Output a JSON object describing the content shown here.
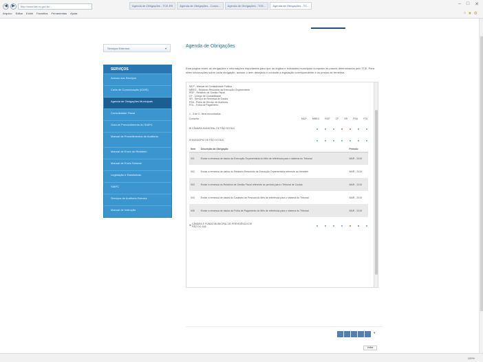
{
  "browser": {
    "address": "http://www.tce.rs.gov.br/...",
    "tabs": [
      "Agenda de Obrigações - TCE-RS",
      "Agenda de Obrigações - Conex...",
      "Agenda de Obrigações - TCE...",
      "Agenda de Obrigações - TC..."
    ],
    "menu": [
      "Arquivo",
      "Editar",
      "Exibir",
      "Favoritos",
      "Ferramentas",
      "Ajuda"
    ]
  },
  "sidebar": {
    "dropdown_label": "Serviços Externos",
    "header": "SERVIÇOS",
    "items": [
      "Acesso aos Serviços",
      "Carta de Comunicação (ICMS)",
      "Agenda de Obrigações Municipais",
      "Consolidador Fiscal",
      "Guia de Preenchimento do SIAPC",
      "Manual de Procedimentos de Auditoria",
      "Manual de Envio do Relatório",
      "Manual de Envio Setorial",
      "Legislação e Estatísticas",
      "SIAPC",
      "Serviços de Auditoria Externa",
      "Manual de Instrução"
    ]
  },
  "main": {
    "title": "Agenda de Obrigações",
    "intro": "Esta página reúne as obrigações e informações importantes para que os órgãos e entidades municipais cumpram os prazos determinados pelo TCE. Para obter informações sobre cada obrigação, acesse o item desejado e consulte a legislação correspondente e os prazos de remessa.",
    "legend": [
      "MCP - Manual de Contabilidade Pública",
      "MREO - Relatório Resumido da Execução Orçamentária",
      "RGF - Relatório de Gestão Fiscal",
      "CF - Código de Contabilidade",
      "SR - Serviço de Remessa de Dados",
      "PSA - Plano de Serviço de Auditoria",
      "FOL - Folha de Pagamento"
    ],
    "count_line": "1 - 3 de 3 - itens encontrados",
    "filter_label": "Consulta",
    "col_labels": [
      "MCP",
      "MREO",
      "RGF",
      "CF",
      "SR",
      "PSA",
      "FOL"
    ],
    "entities": [
      {
        "name": "CÂMARA MUNICIPAL DE PÃO DO SUL"
      },
      {
        "name": "MUNICÍPIO DE PÃO DO SUL"
      }
    ],
    "table": {
      "headers": [
        "Item",
        "Descrição da Obrigação",
        "Período"
      ],
      "rows": [
        {
          "item": "001",
          "desc": "Enviar a remessa de dados da Execução Orçamentária do Mês de referência para o sistema do Tribunal",
          "period": "MAR - 2019",
          "shaded": true
        },
        {
          "item": "002",
          "desc": "Enviar a remessa de dados do Relatório Resumido da Execução Orçamentária referente ao bimestre",
          "period": "MAR - 2019",
          "shaded": false
        },
        {
          "item": "003",
          "desc": "Enviar a remessa do Relatório de Gestão Fiscal referente ao período para o Tribunal de Contas",
          "period": "MAR - 2019",
          "shaded": true
        },
        {
          "item": "004",
          "desc": "Enviar a remessa de dados do Cadastro de Pessoal do Mês de referência para o sistema do Tribunal",
          "period": "MAR - 2019",
          "shaded": false
        },
        {
          "item": "005",
          "desc": "Enviar a remessa de dados da Folha de Pagamento do Mês de referência para o sistema do Tribunal",
          "period": "MAR - 2019",
          "shaded": true
        }
      ]
    },
    "last_entity": "CÂMARA E FUNDO MUNICIPAL DE PREVIDÊNCIA DE PÃO DO SUL"
  },
  "footer": {
    "button": "Voltar",
    "zoom": "100%"
  }
}
